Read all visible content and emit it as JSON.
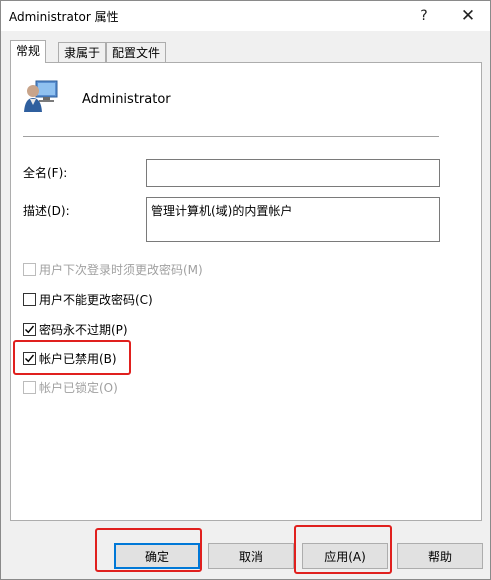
{
  "window": {
    "title": "Administrator 属性",
    "help_glyph": "?",
    "close_glyph": "✕"
  },
  "tabs": [
    {
      "label": "常规",
      "active": true
    },
    {
      "label": "隶属于",
      "active": false
    },
    {
      "label": "配置文件",
      "active": false
    }
  ],
  "general": {
    "user_icon": "user-monitor-icon",
    "user_name": "Administrator",
    "fullname_label": "全名(F):",
    "fullname_value": "",
    "description_label": "描述(D):",
    "description_value": "管理计算机(域)的内置帐户"
  },
  "checkboxes": [
    {
      "label": "用户下次登录时须更改密码(M)",
      "checked": false,
      "disabled": true
    },
    {
      "label": "用户不能更改密码(C)",
      "checked": false,
      "disabled": false
    },
    {
      "label": "密码永不过期(P)",
      "checked": true,
      "disabled": false
    },
    {
      "label": "帐户已禁用(B)",
      "checked": true,
      "disabled": false
    },
    {
      "label": "帐户已锁定(O)",
      "checked": false,
      "disabled": true
    }
  ],
  "buttons": {
    "ok": "确定",
    "cancel": "取消",
    "apply": "应用(A)",
    "help": "帮助"
  },
  "colors": {
    "highlight": "#e0201e",
    "accent": "#0078d7"
  }
}
